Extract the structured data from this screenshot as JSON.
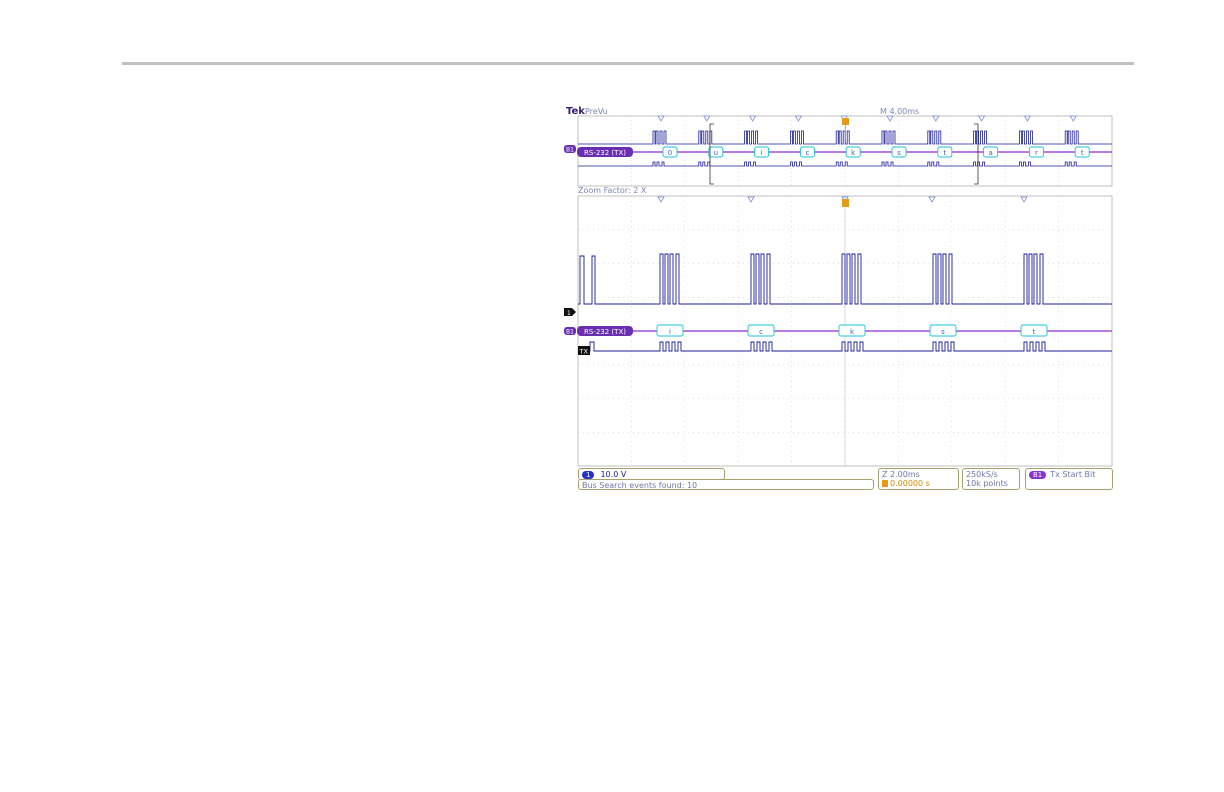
{
  "header": {
    "brand": "Tek",
    "mode": "PreVu",
    "timebase": "M 4.00ms"
  },
  "overview": {
    "bus_label": "RS-232 (TX)",
    "bus_channel": "B1",
    "decoded_bytes": [
      "0",
      "u",
      "i",
      "c",
      "k",
      "s",
      "t",
      "a",
      "r",
      "t"
    ]
  },
  "zoom": {
    "factor_label": "Zoom Factor: 2 X",
    "bus_label": "RS-232 (TX)",
    "bus_channel": "B1",
    "decoded_bytes": [
      "i",
      "c",
      "k",
      "s",
      "t"
    ],
    "digital_label": "TX",
    "analog_channel": "1"
  },
  "status_bar": {
    "channel": "1",
    "volts_per_div": "10.0 V",
    "search_result": "Bus Search events found: 10",
    "zoom_time": "Z 2.00ms",
    "trigger_position": "0.00000 s",
    "sample_rate": "250kS/s",
    "record_length": "10k points",
    "trigger_source": "B1",
    "trigger_type": "Tx Start Bit"
  },
  "colors": {
    "analog": "#1a1f99",
    "bus": "#8a2fd0",
    "decode_box": "#19c3d6",
    "grid": "#b8b8b8",
    "trigger": "#e69a1a",
    "search_marker": "#7b8fd6"
  }
}
